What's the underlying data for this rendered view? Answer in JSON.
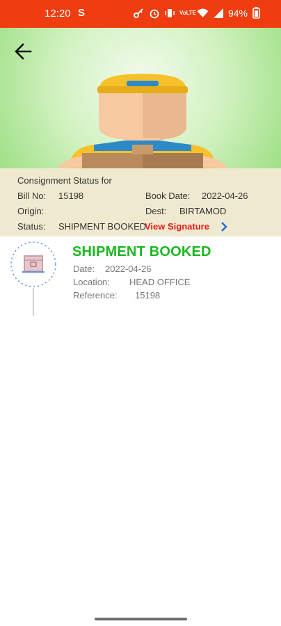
{
  "status_bar": {
    "time": "12:20",
    "app_indicator": "S",
    "network_label": "VoLTE",
    "battery_pct": "94%"
  },
  "header": {
    "back_icon": "arrow-left-icon"
  },
  "consignment": {
    "heading": "Consignment Status for",
    "bill_no_label": "Bill No:",
    "bill_no": "15198",
    "book_date_label": "Book Date:",
    "book_date": "2022-04-26",
    "origin_label": "Origin:",
    "origin": "",
    "dest_label": "Dest:",
    "dest": "BIRTAMOD",
    "status_label": "Status:",
    "status": "SHIPMENT BOOKED",
    "view_signature": "View Signature"
  },
  "timeline": [
    {
      "title": "SHIPMENT BOOKED",
      "date_label": "Date:",
      "date": "2022-04-26",
      "location_label": "Location:",
      "location": "HEAD OFFICE",
      "reference_label": "Reference:",
      "reference": "15198"
    }
  ],
  "colors": {
    "status_bar": "#ef3d0f",
    "accent_green": "#19b81e",
    "link_red": "#e31b1b",
    "info_bg": "#efeacf",
    "chevron_blue": "#2266dd"
  }
}
